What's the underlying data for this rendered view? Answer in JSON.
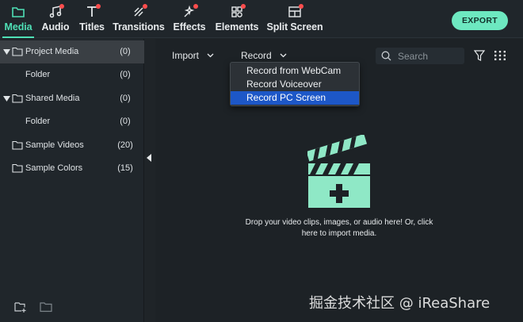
{
  "toolbar": {
    "tabs": [
      {
        "label": "Media",
        "icon": "folder-icon",
        "active": true,
        "badge": false
      },
      {
        "label": "Audio",
        "icon": "music-note-icon",
        "active": false,
        "badge": true
      },
      {
        "label": "Titles",
        "icon": "text-icon",
        "active": false,
        "badge": true
      },
      {
        "label": "Transitions",
        "icon": "transition-icon",
        "active": false,
        "badge": true
      },
      {
        "label": "Effects",
        "icon": "effects-icon",
        "active": false,
        "badge": true
      },
      {
        "label": "Elements",
        "icon": "elements-icon",
        "active": false,
        "badge": true
      },
      {
        "label": "Split Screen",
        "icon": "split-screen-icon",
        "active": false,
        "badge": true
      }
    ],
    "export_label": "EXPORT"
  },
  "library": {
    "items": [
      {
        "label": "Project Media",
        "count": "(0)",
        "level": 0,
        "expanded": true,
        "selected": true
      },
      {
        "label": "Folder",
        "count": "(0)",
        "level": 1
      },
      {
        "label": "Shared Media",
        "count": "(0)",
        "level": 0,
        "expanded": true
      },
      {
        "label": "Folder",
        "count": "(0)",
        "level": 1
      },
      {
        "label": "Sample Videos",
        "count": "(20)",
        "level": 0
      },
      {
        "label": "Sample Colors",
        "count": "(15)",
        "level": 0
      }
    ]
  },
  "media_bar": {
    "import_label": "Import",
    "record_label": "Record",
    "search_placeholder": "Search"
  },
  "record_menu": {
    "items": [
      {
        "label": "Record from WebCam",
        "highlighted": false
      },
      {
        "label": "Record Voiceover",
        "highlighted": false
      },
      {
        "label": "Record PC Screen",
        "highlighted": true
      }
    ]
  },
  "empty_state": {
    "line1": "Drop your video clips, images, or audio here! Or, click",
    "line2": "here to import media."
  },
  "watermark": "掘金技术社区 @ iReaShare",
  "colors": {
    "accent": "#4fe0b6",
    "export_bg": "#6de8c0",
    "badge": "#ff4d4d",
    "menu_highlight": "#1d57c7",
    "clapper": "#8fe8c6"
  }
}
